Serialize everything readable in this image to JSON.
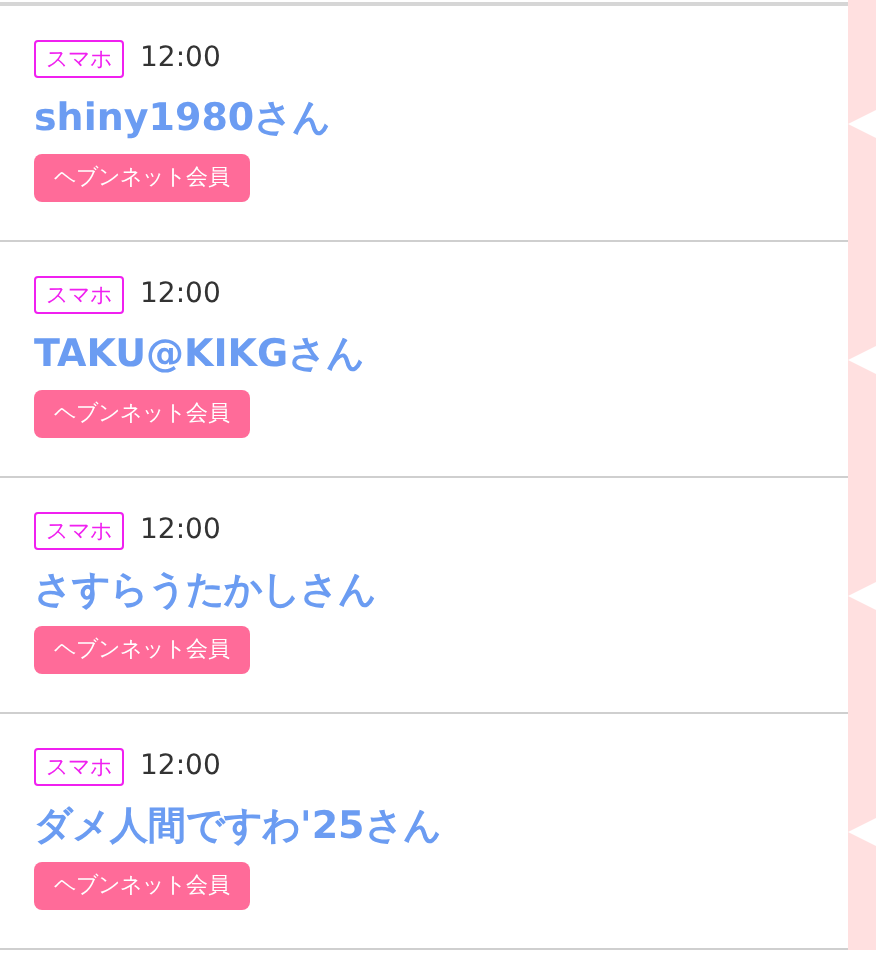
{
  "entries": [
    {
      "device": "スマホ",
      "time": "12:00",
      "name": "shiny1980さん",
      "member_badge": "ヘブンネット会員"
    },
    {
      "device": "スマホ",
      "time": "12:00",
      "name": "TAKU@KIKGさん",
      "member_badge": "ヘブンネット会員"
    },
    {
      "device": "スマホ",
      "time": "12:00",
      "name": "さすらうたかしさん",
      "member_badge": "ヘブンネット会員"
    },
    {
      "device": "スマホ",
      "time": "12:00",
      "name": "ダメ人間ですわ'25さん",
      "member_badge": "ヘブンネット会員"
    }
  ]
}
